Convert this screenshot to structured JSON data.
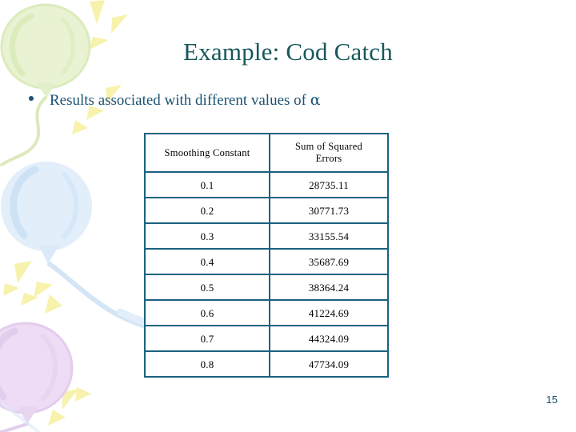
{
  "slide": {
    "title": "Example: Cod Catch",
    "page_number": "15",
    "colors": {
      "title": "#17575c",
      "body_text": "#1a5272",
      "table_border": "#1a627f",
      "balloon_green": "#e4f0c8",
      "balloon_blue": "#d9e9f7",
      "balloon_purple": "#e9d7f0",
      "sparkle_yellow": "#f7f2a8"
    }
  },
  "bullet": {
    "marker": "bullet-dot",
    "text_before_alpha": "Results associated with different values of ",
    "alpha_symbol": "α"
  },
  "table": {
    "headers": [
      "Smoothing Constant",
      "Sum of Squared Errors"
    ],
    "header_line1_col2": "Sum of Squared",
    "header_line2_col2": "Errors",
    "rows": [
      {
        "smoothing_constant": "0.1",
        "sum_of_squared_errors": "28735.11"
      },
      {
        "smoothing_constant": "0.2",
        "sum_of_squared_errors": "30771.73"
      },
      {
        "smoothing_constant": "0.3",
        "sum_of_squared_errors": "33155.54"
      },
      {
        "smoothing_constant": "0.4",
        "sum_of_squared_errors": "35687.69"
      },
      {
        "smoothing_constant": "0.5",
        "sum_of_squared_errors": "38364.24"
      },
      {
        "smoothing_constant": "0.6",
        "sum_of_squared_errors": "41224.69"
      },
      {
        "smoothing_constant": "0.7",
        "sum_of_squared_errors": "44324.09"
      },
      {
        "smoothing_constant": "0.8",
        "sum_of_squared_errors": "47734.09"
      }
    ]
  },
  "decoration": {
    "balloons": [
      {
        "name": "balloon-green",
        "color": "#e4f0c8"
      },
      {
        "name": "balloon-blue",
        "color": "#d9e9f7"
      },
      {
        "name": "balloon-purple",
        "color": "#e9d7f0"
      }
    ],
    "sparkle_color": "#f7f2a8"
  }
}
